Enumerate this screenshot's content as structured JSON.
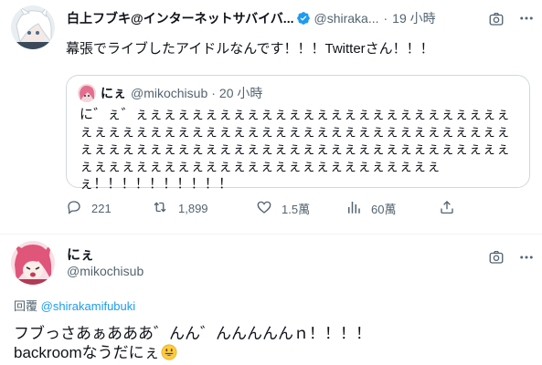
{
  "tweet": {
    "display_name": "白上フブキ@インターネットサバイバ...",
    "handle": "@shiraka...",
    "separator": "·",
    "time": "19 小時",
    "text": "幕張でライブしたアイドルなんです！！！Twitterさん！！！",
    "quote": {
      "display_name": "にぇ",
      "handle": "@mikochisub",
      "separator": "·",
      "time": "20 小時",
      "text": "に゛ぇ゛ぇぇぇぇぇぇぇぇぇぇぇぇぇぇぇぇぇぇぇぇぇぇぇぇぇぇぇぇぇぇぇぇぇぇぇぇぇぇぇぇぇぇぇぇぇぇぇぇぇぇぇぇぇぇぇぇぇぇぇぇぇぇぇぇぇぇぇぇぇぇぇぇぇぇぇぇぇぇぇぇぇぇぇぇぇぇぇぇぇぇぇぇぇぇぇぇぇぇぇぇぇぇぇぇぇぇぇぇぇぇぇぇぇぇぇぇ！！！！！！！！！！"
    },
    "actions": {
      "reply_count": "221",
      "retweet_count": "1,899",
      "like_count": "1.5萬",
      "views_count": "60萬"
    },
    "icons": [
      "verified-badge-icon",
      "camera-icon",
      "reply-icon",
      "retweet-icon",
      "like-icon",
      "views-icon",
      "share-icon"
    ]
  },
  "reply": {
    "display_name": "にぇ",
    "handle": "@mikochisub",
    "replying_label": "回覆",
    "replying_to": "@shirakamifubuki",
    "line1": "フブっさあぁあああ゛んん゛んんんんんｎ！！！！",
    "line2": "backroomなうだにぇ"
  },
  "colors": {
    "accent": "#1d9bf0",
    "secondary_text": "#536471",
    "border": "#cfd9de"
  }
}
